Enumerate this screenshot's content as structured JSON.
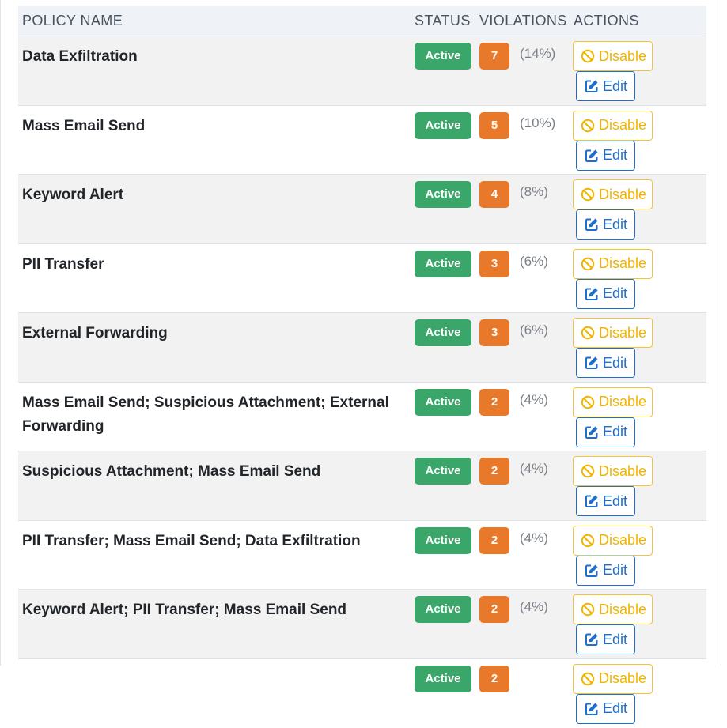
{
  "columns": {
    "name": "POLICY NAME",
    "status": "STATUS",
    "violations": "VIOLATIONS",
    "actions": "ACTIONS"
  },
  "colors": {
    "active_badge": "#3aa66a",
    "count_badge": "#e8782a",
    "disable_button": "#f0b400",
    "edit_button": "#1d6fcf"
  },
  "rows": [
    {
      "name": "Data Exfiltration",
      "status": "Active",
      "count": "7",
      "pct": "(14%)",
      "disable": "Disable",
      "edit": "Edit"
    },
    {
      "name": "Mass Email Send",
      "status": "Active",
      "count": "5",
      "pct": "(10%)",
      "disable": "Disable",
      "edit": "Edit"
    },
    {
      "name": "Keyword Alert",
      "status": "Active",
      "count": "4",
      "pct": "(8%)",
      "disable": "Disable",
      "edit": "Edit"
    },
    {
      "name": "PII Transfer",
      "status": "Active",
      "count": "3",
      "pct": "(6%)",
      "disable": "Disable",
      "edit": "Edit"
    },
    {
      "name": "External Forwarding",
      "status": "Active",
      "count": "3",
      "pct": "(6%)",
      "disable": "Disable",
      "edit": "Edit"
    },
    {
      "name": "Mass Email Send; Suspicious Attachment; External Forwarding",
      "status": "Active",
      "count": "2",
      "pct": "(4%)",
      "disable": "Disable",
      "edit": "Edit"
    },
    {
      "name": "Suspicious Attachment; Mass Email Send",
      "status": "Active",
      "count": "2",
      "pct": "(4%)",
      "disable": "Disable",
      "edit": "Edit"
    },
    {
      "name": "PII Transfer; Mass Email Send; Data Exfiltration",
      "status": "Active",
      "count": "2",
      "pct": "(4%)",
      "disable": "Disable",
      "edit": "Edit"
    },
    {
      "name": "Keyword Alert; PII Transfer; Mass Email Send",
      "status": "Active",
      "count": "2",
      "pct": "(4%)",
      "disable": "Disable",
      "edit": "Edit"
    },
    {
      "name": "",
      "status": "Active",
      "count": "2",
      "pct": "",
      "disable": "Disable",
      "edit": "Edit"
    }
  ],
  "icons": {
    "disable": "ban-icon",
    "edit": "edit-icon"
  }
}
